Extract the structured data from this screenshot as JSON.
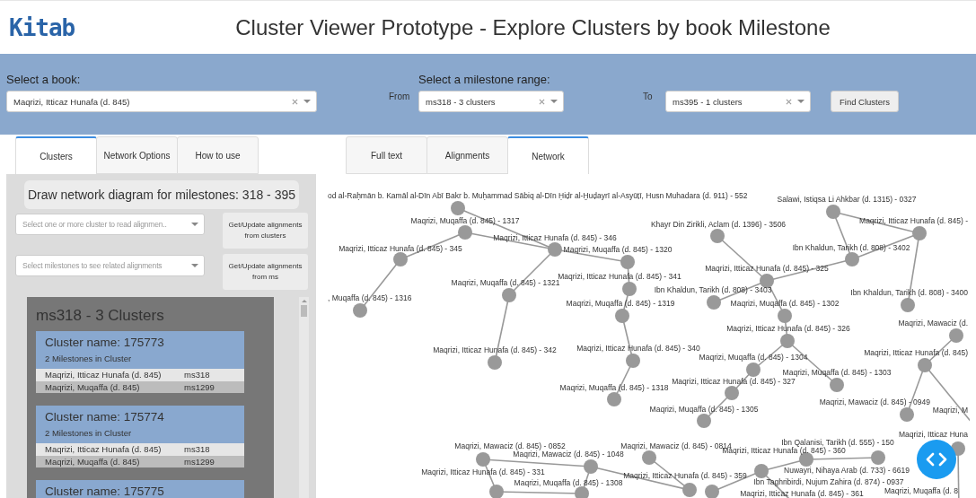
{
  "header": {
    "logo": "Kitab",
    "title": "Cluster Viewer Prototype - Explore Clusters by book Milestone"
  },
  "filters": {
    "book": {
      "label": "Select a book:",
      "value": "Maqrizi, Itticaz Hunafa (d. 845)"
    },
    "from_label": "From",
    "from": {
      "label": "Select a milestone range:",
      "value": "ms318 - 3 clusters"
    },
    "to_label": "To",
    "to": {
      "value": "ms395 - 1 clusters"
    },
    "button": "Find Clusters"
  },
  "left_tabs": [
    {
      "label": "Clusters",
      "selected": true
    },
    {
      "label": "Network Options",
      "selected": false
    },
    {
      "label": "How to use",
      "selected": false
    }
  ],
  "right_tabs": [
    {
      "label": "Full text",
      "selected": false
    },
    {
      "label": "Alignments",
      "selected": false
    },
    {
      "label": "Network",
      "selected": true
    }
  ],
  "panel": {
    "heading": "Draw network diagram for milestones: 318 - 395",
    "controls": [
      {
        "placeholder": "Select one or more cluster to read alignmen..",
        "button": "Get/Update alignments from clusters"
      },
      {
        "placeholder": "Select milestones to see related alignments",
        "button": "Get/Update alignments from ms"
      }
    ],
    "group_title": "ms318 - 3 Clusters",
    "clusters": [
      {
        "name": "Cluster name: 175773",
        "count": "2 Milestones in Cluster",
        "rows": [
          {
            "book": "Maqrizi, Itticaz Hunafa (d. 845)",
            "ms": "ms318"
          },
          {
            "book": "Maqrizi, Muqaffa (d. 845)",
            "ms": "ms1299"
          }
        ]
      },
      {
        "name": "Cluster name: 175774",
        "count": "2 Milestones in Cluster",
        "rows": [
          {
            "book": "Maqrizi, Itticaz Hunafa (d. 845)",
            "ms": "ms318"
          },
          {
            "book": "Maqrizi, Muqaffa (d. 845)",
            "ms": "ms1299"
          }
        ]
      },
      {
        "name": "Cluster name: 175775"
      }
    ]
  },
  "network": {
    "nodes": [
      {
        "label": "od al-Raḥmān b. Kamāl al-Dīn Abī Bakr b. Muḥammad Sābiq al-Dīn Ḥiḍr al-Ḫuḍayrī al-Asyūṭī, Husn Muhadara (d. 911) - 552"
      },
      {
        "label": "Maqrizi, Muqaffa (d. 845) - 1317"
      },
      {
        "label": "Maqrizi, Itticaz Hunafa (d. 845) - 345"
      },
      {
        "label": ", Muqaffa (d. 845) - 1316"
      },
      {
        "label": "Maqrizi, Itticaz Hunafa (d. 845) - 346"
      },
      {
        "label": "Maqrizi, Muqaffa (d. 845) - 1320"
      },
      {
        "label": "Maqrizi, Muqaffa (d. 845) - 1321"
      },
      {
        "label": "Maqrizi, Itticaz Hunafa (d. 845) - 342"
      },
      {
        "label": "Maqrizi, Itticaz Hunafa (d. 845) - 341"
      },
      {
        "label": "Maqrizi, Muqaffa (d. 845) - 1319"
      },
      {
        "label": "Maqrizi, Itticaz Hunafa (d. 845) - 340"
      },
      {
        "label": "Maqrizi, Muqaffa (d. 845) - 1318"
      },
      {
        "label": "Salawi, Istiqsa Li Ahkbar (d. 1315) - 0327"
      },
      {
        "label": "Maqrizi, Itticaz Hunafa (d. 845) -"
      },
      {
        "label": "Ibn Khaldun, Tarikh (d. 808) - 3402"
      },
      {
        "label": "Khayr Din Zirikli, Aclam (d. 1396) - 3506"
      },
      {
        "label": "Maqrizi, Itticaz Hunafa (d. 845) - 325"
      },
      {
        "label": "Ibn Khaldun, Tarikh (d. 808) - 3403"
      },
      {
        "label": "Maqrizi, Muqaffa (d. 845) - 1302"
      },
      {
        "label": "Ibn Khaldun, Tarikh (d. 808) - 3400"
      },
      {
        "label": "Maqrizi, Itticaz Hunafa (d. 845) - 326"
      },
      {
        "label": "Maqrizi, Muqaffa (d. 845) - 1304"
      },
      {
        "label": "Maqrizi, Muqaffa (d. 845) - 1303"
      },
      {
        "label": "Maqrizi, Itticaz Hunafa (d. 845) - 327"
      },
      {
        "label": "Maqrizi, Muqaffa (d. 845) - 1305"
      },
      {
        "label": "Maqrizi, Mawaciz (d."
      },
      {
        "label": "Maqrizi, Itticaz Hunafa (d. 845)"
      },
      {
        "label": "Maqrizi, Mawaciz (d. 845) - 0949"
      },
      {
        "label": "Maqrizi, M"
      },
      {
        "label": "Maqrizi, Mawaciz (d. 845) - 0852"
      },
      {
        "label": "Maqrizi, Mawaciz (d. 845) - 0814"
      },
      {
        "label": "Maqrizi, Mawaciz (d. 845) - 1048"
      },
      {
        "label": "Maqrizi, Itticaz Hunafa (d. 845) - 331"
      },
      {
        "label": "Maqrizi, Muqaffa (d. 845) - 1308"
      },
      {
        "label": "Maqrizi, Itticaz Hunafa (d. 845) - 359"
      },
      {
        "label": "Ibn Qalanisi, Tarikh (d. 555) - 150"
      },
      {
        "label": "Maqrizi, Itticaz Hunafa (d. 845) - 360"
      },
      {
        "label": "Nuwayri, Nihaya Arab (d. 733) - 6619"
      },
      {
        "label": "Ibn Taghribirdi, Nujum Zahira (d. 874) - 0937"
      },
      {
        "label": "Maqrizi, Itticaz Hunafa (d. 845) - 361"
      },
      {
        "label": "Maqrizi, Itticaz Huna"
      },
      {
        "label": "Maqrizi, Muqaffa (d. 8"
      }
    ]
  }
}
